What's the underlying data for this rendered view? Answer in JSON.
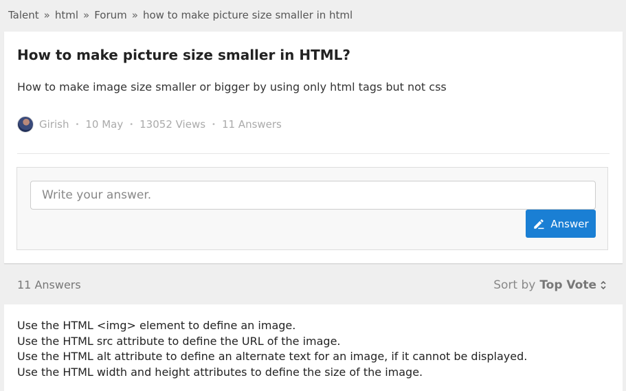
{
  "breadcrumb": {
    "items": [
      "Talent",
      "html",
      "Forum",
      "how to make picture size smaller in html"
    ],
    "separator": "»"
  },
  "question": {
    "title": "How to make picture size smaller in HTML?",
    "body": "How to make image size smaller or bigger by using only html tags but not css",
    "author": "Girish",
    "date": "10 May",
    "views": "13052 Views",
    "answers": "11 Answers",
    "meta_dot": "•"
  },
  "answer_form": {
    "placeholder": "Write your answer.",
    "button_label": "Answer",
    "button_icon": "pencil-icon"
  },
  "answers_header": {
    "count_label": "11 Answers",
    "sort_prefix": "Sort by",
    "sort_value": "Top Vote",
    "sort_icon": "sort-chevrons-icon"
  },
  "top_answer": {
    "lines": [
      "Use the HTML <img> element to define an image.",
      "Use the HTML src attribute to define the URL of the image.",
      "Use the HTML alt attribute to define an alternate text for an image, if it cannot be displayed.",
      "Use the HTML width and height attributes to define the size of the image."
    ]
  },
  "colors": {
    "accent": "#1a7fd4",
    "page_bg": "#efefef",
    "card_bg": "#ffffff"
  }
}
